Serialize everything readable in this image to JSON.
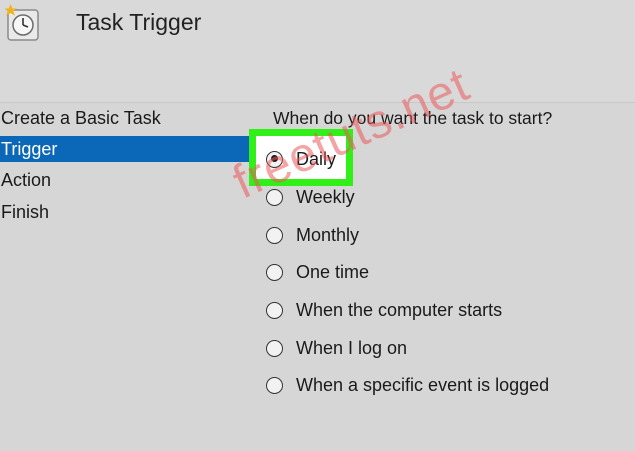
{
  "window": {
    "title": "Task Trigger",
    "icon": "clock-icon"
  },
  "sidebar": {
    "items": [
      {
        "label": "Create a Basic Task",
        "selected": false
      },
      {
        "label": "Trigger",
        "selected": true
      },
      {
        "label": "Action",
        "selected": false
      },
      {
        "label": "Finish",
        "selected": false
      }
    ]
  },
  "main": {
    "question": "When do you want the task to start?",
    "options": [
      {
        "label": "Daily",
        "checked": true
      },
      {
        "label": "Weekly",
        "checked": false
      },
      {
        "label": "Monthly",
        "checked": false
      },
      {
        "label": "One time",
        "checked": false
      },
      {
        "label": "When the computer starts",
        "checked": false
      },
      {
        "label": "When I log on",
        "checked": false
      },
      {
        "label": "When a specific event is logged",
        "checked": false
      }
    ]
  },
  "overlay": {
    "highlight_color": "#31f018",
    "selection_color": "#0b67b8",
    "watermark": "freetuts.net"
  }
}
